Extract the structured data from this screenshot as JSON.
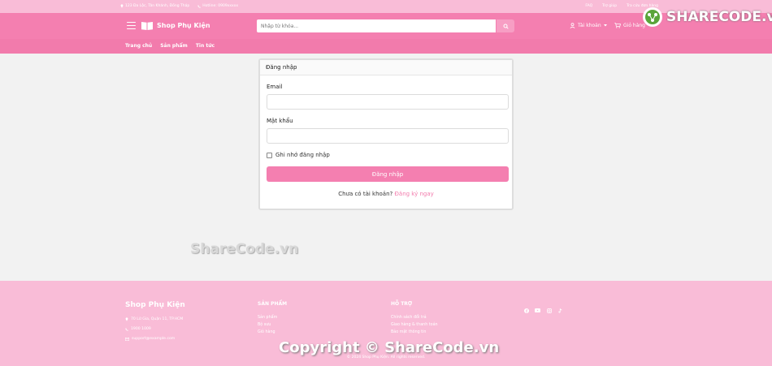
{
  "topbar": {
    "address": "123 Đa Lộc, Tân Khánh, Đồng Tháp",
    "hotline": "Hotline: 0909xxxxx",
    "links": [
      "FAQ",
      "Trợ giúp",
      "Tra cứu đơn hàng"
    ]
  },
  "header": {
    "brand": "Shop Phụ Kiện",
    "search_placeholder": "Nhập từ khóa...",
    "account_label": "Tài khoản",
    "cart_label": "Giỏ hàng"
  },
  "nav": [
    "Trang chủ",
    "Sản phẩm",
    "Tin tức"
  ],
  "login": {
    "title": "Đăng nhập",
    "email_label": "Email",
    "email_value": "",
    "password_label": "Mật khẩu",
    "password_value": "",
    "remember_label": "Ghi nhớ đăng nhập",
    "submit_label": "Đăng nhập",
    "no_account_text": "Chưa có tài khoản?",
    "register_link": "Đăng ký ngay"
  },
  "watermark": {
    "center": "ShareCode.vn",
    "copyright": "Copyright © ShareCode.vn",
    "brand": "SHARECODE.vn"
  },
  "footer": {
    "brand": "Shop Phụ Kiện",
    "address": "70 Lữ Gia, Quận 11, TP.HCM",
    "phone": "1900 1009",
    "email": "support@example.com",
    "col1_title": "SẢN PHẨM",
    "col1_links": [
      "Sản phẩm",
      "Bộ sưu",
      "Giỏ hàng"
    ],
    "col2_title": "HỖ TRỢ",
    "col2_links": [
      "Chính sách đổi trả",
      "Giao hàng & thanh toán",
      "Bảo mật thông tin"
    ],
    "social_icons": [
      "facebook-icon",
      "youtube-icon",
      "instagram-icon",
      "tiktok-icon"
    ],
    "copyright": "© 2024 Shop Phụ Kiện. All rights reserved."
  },
  "colors": {
    "primary": "#f47fb0",
    "topbar": "#f9bcd7",
    "nav": "#f27bac",
    "footer": "#f9bcd7",
    "page_bg": "#f2f2f2"
  }
}
